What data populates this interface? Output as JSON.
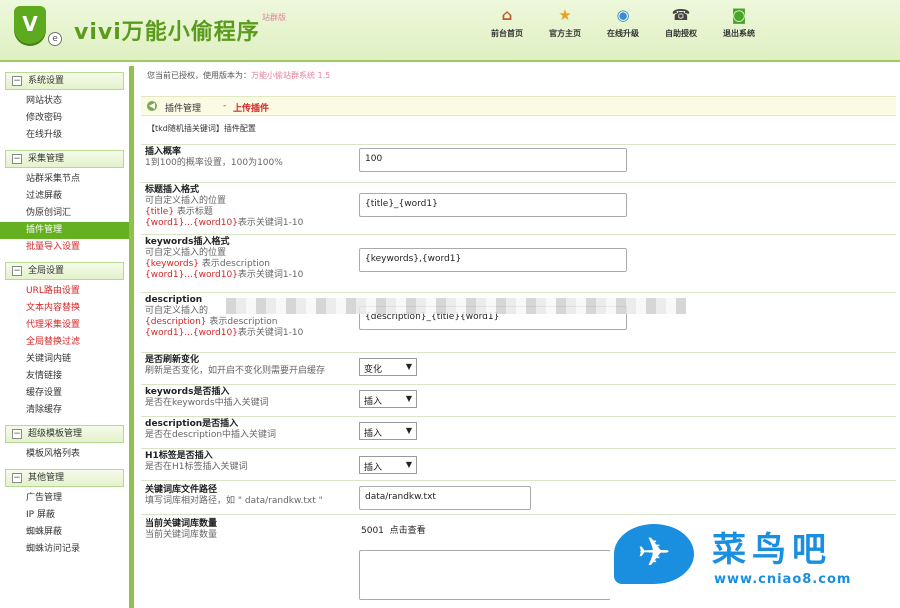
{
  "header": {
    "logo_letter": "V",
    "logo_badge": "e",
    "title": "vivi万能小偷程序",
    "badge": "站群版",
    "nav": [
      {
        "label": "前台首页",
        "icon": "home-icon",
        "glyph": "⌂",
        "color": "#c05a2a"
      },
      {
        "label": "官方主页",
        "icon": "star-icon",
        "glyph": "★",
        "color": "#e8a21c"
      },
      {
        "label": "在线升级",
        "icon": "globe-icon",
        "glyph": "◉",
        "color": "#3b8ad6"
      },
      {
        "label": "自助授权",
        "icon": "phone-icon",
        "glyph": "☎",
        "color": "#444444"
      },
      {
        "label": "退出系统",
        "icon": "rss-exit-icon",
        "glyph": "◙",
        "color": "#4aa62a"
      }
    ]
  },
  "sidebar": {
    "groups": [
      {
        "title": "系统设置",
        "items": [
          {
            "label": "网站状态"
          },
          {
            "label": "修改密码"
          },
          {
            "label": "在线升级"
          }
        ]
      },
      {
        "title": "采集管理",
        "items": [
          {
            "label": "站群采集节点"
          },
          {
            "label": "过滤屏蔽"
          },
          {
            "label": "伪原创词汇"
          },
          {
            "label": "插件管理"
          },
          {
            "label": "批量导入设置"
          }
        ]
      },
      {
        "title": "全局设置",
        "items": [
          {
            "label": "URL路由设置"
          },
          {
            "label": "文本内容替换"
          },
          {
            "label": "代理采集设置"
          },
          {
            "label": "全局替换过滤"
          },
          {
            "label": "关键词内链"
          },
          {
            "label": "友情链接"
          },
          {
            "label": "缓存设置"
          },
          {
            "label": "清除缓存"
          }
        ]
      },
      {
        "title": "超级模板管理",
        "items": [
          {
            "label": "模板风格列表"
          }
        ]
      },
      {
        "title": "其他管理",
        "items": [
          {
            "label": "广告管理"
          },
          {
            "label": "IP 屏蔽"
          },
          {
            "label": "蜘蛛屏蔽"
          },
          {
            "label": "蜘蛛访问记录"
          }
        ]
      }
    ]
  },
  "main": {
    "notice_prefix": "您当前已授权，使用版本为：",
    "notice_version": "万能小偷站群系统 1.5",
    "crumb_icon": "◀",
    "crumb_parent": "插件管理",
    "crumb_sep": "-",
    "crumb_current": "上传插件",
    "page_title": "【tkd随机插关键词】插件配置",
    "fields": {
      "rate": {
        "label": "插入概率",
        "help": "1到100的概率设置，100为100%",
        "value": "100"
      },
      "title_fmt": {
        "label": "标题插入格式",
        "help1": "可自定义插入的位置",
        "help2a": "{title}",
        "help2b": " 表示标题",
        "help3a": "{word1}...{word10}",
        "help3b": "表示关键词1-10",
        "value": "{title}_{word1}"
      },
      "kw_fmt": {
        "label": "keywords插入格式",
        "help1": "可自定义插入的位置",
        "help2a": "{keywords}",
        "help2b": " 表示description",
        "help3a": "{word1}...{word10}",
        "help3b": "表示关键词1-10",
        "value": "{keywords},{word1}"
      },
      "desc_fmt": {
        "label": "description",
        "help1": "可自定义插入的",
        "help2a": "{description}",
        "help2b": " 表示description",
        "help3a": "{word1}...{word10}",
        "help3b": "表示关键词1-10",
        "value": "{description}_{title}{word1}"
      },
      "refresh": {
        "label": "是否刷新变化",
        "help": "刷新是否变化，如开启不变化则需要开启缓存",
        "value": "变化"
      },
      "kw_insert": {
        "label": "keywords是否插入",
        "help": "是否在keywords中插入关键词",
        "value": "插入"
      },
      "desc_insert": {
        "label": "description是否插入",
        "help": "是否在description中插入关键词",
        "value": "插入"
      },
      "h1_insert": {
        "label": "H1标签是否插入",
        "help": "是否在H1标签插入关键词",
        "value": "插入"
      },
      "kw_path": {
        "label": "关键词库文件路径",
        "help": "填写词库相对路径，如 \" data/randkw.txt \"",
        "value": "data/randkw.txt"
      },
      "kw_count": {
        "label": "当前关键词库数量",
        "help": "当前关键词库数量",
        "count": "5001",
        "link": "点击查看"
      }
    }
  },
  "watermark": {
    "title": "菜鸟吧",
    "url": "www.cniao8.com",
    "icon": "bird-logo-icon"
  }
}
